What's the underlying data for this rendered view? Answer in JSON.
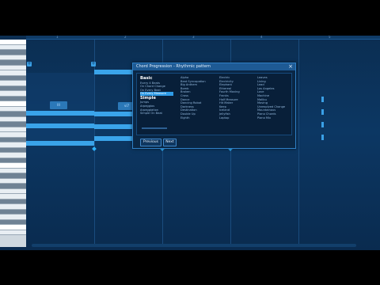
{
  "timeline": {
    "ruler": [
      "1",
      "2",
      "3",
      "4",
      "5"
    ]
  },
  "piano": {
    "keys": [
      {
        "label": "",
        "kind": "c"
      },
      {
        "label": "",
        "kind": "white"
      },
      {
        "label": "",
        "kind": "black"
      },
      {
        "label": "",
        "kind": "white"
      },
      {
        "label": "",
        "kind": "black"
      },
      {
        "label": "",
        "kind": "white"
      },
      {
        "label": "",
        "kind": "white"
      },
      {
        "label": "",
        "kind": "black"
      },
      {
        "label": "",
        "kind": "white"
      },
      {
        "label": "",
        "kind": "black"
      },
      {
        "label": "",
        "kind": "white"
      },
      {
        "label": "",
        "kind": "black"
      },
      {
        "label": "",
        "kind": "c"
      },
      {
        "label": "",
        "kind": "white"
      },
      {
        "label": "",
        "kind": "black"
      },
      {
        "label": "",
        "kind": "white"
      },
      {
        "label": "",
        "kind": "black"
      },
      {
        "label": "",
        "kind": "white"
      },
      {
        "label": "",
        "kind": "white"
      },
      {
        "label": "",
        "kind": "black"
      },
      {
        "label": "",
        "kind": "white"
      },
      {
        "label": "",
        "kind": "black"
      },
      {
        "label": "",
        "kind": "white"
      },
      {
        "label": "",
        "kind": "black"
      },
      {
        "label": "",
        "kind": "c"
      },
      {
        "label": "",
        "kind": "white"
      },
      {
        "label": "",
        "kind": "black"
      },
      {
        "label": "",
        "kind": "white"
      },
      {
        "label": "",
        "kind": "black"
      },
      {
        "label": "",
        "kind": "white"
      },
      {
        "label": "",
        "kind": "white"
      },
      {
        "label": "",
        "kind": "black"
      },
      {
        "label": "",
        "kind": "white"
      },
      {
        "label": "",
        "kind": "black"
      },
      {
        "label": "",
        "kind": "white"
      },
      {
        "label": "",
        "kind": "black"
      },
      {
        "label": "",
        "kind": "c"
      },
      {
        "label": "",
        "kind": "white"
      }
    ]
  },
  "chords": [
    "III",
    "vi7"
  ],
  "dialog": {
    "title": "Chord Progression - Rhythmic pattern",
    "close": "×",
    "columns": [
      {
        "sections": [
          {
            "heading": "Basic",
            "items": [
              "Every 4 Beats",
              "On Chord Change",
              "On Every Beat",
              "On Every Measure"
            ]
          },
          {
            "heading": "Simple",
            "items": [
              "Jumps",
              "Arpeggios",
              "Arpeggiation",
              "Simple On Beat"
            ]
          }
        ]
      },
      {
        "sections": [
          {
            "heading": "",
            "items": [
              "Alpha",
              "Beat Syncopation",
              "Big Anthem",
              "Bomb",
              "Broken",
              "Cross",
              "Dance",
              "Dancing Robot",
              "Darkness",
              "Destination",
              "Double Up",
              "Eighth"
            ]
          }
        ]
      },
      {
        "sections": [
          {
            "heading": "",
            "items": [
              "Electric",
              "Electricity",
              "Elephant",
              "Ethereal",
              "Fourth Moving",
              "Franks",
              "Half Measure",
              "Hit Maker",
              "Keep",
              "Iceland",
              "Jellyfish",
              "Laptop"
            ]
          }
        ]
      },
      {
        "sections": [
          {
            "heading": "",
            "items": [
              "Leaves",
              "Living",
              "Lead",
              "Los Angeles",
              "Love",
              "Machine",
              "Malibu",
              "Moving",
              "Unresolved Change",
              "Mountainous",
              "Piano Chords",
              "Piano Mix"
            ]
          }
        ]
      }
    ],
    "selected": "On Every Measure",
    "buttons": {
      "previous": "Previous",
      "next": "Next"
    }
  },
  "colors": {
    "accent": "#3aa4ea",
    "background": "#0c3763",
    "dialog": "#0a2745"
  }
}
